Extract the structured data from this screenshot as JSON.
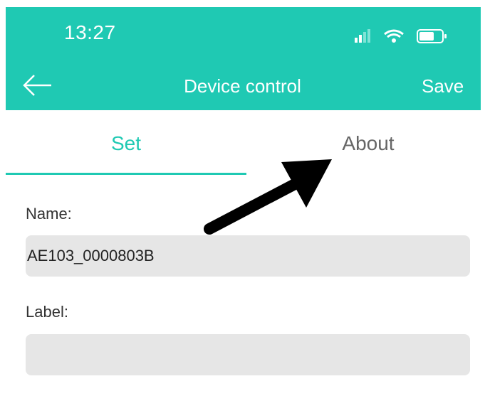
{
  "status_bar": {
    "time": "13:27",
    "icons": [
      "cellular-signal-icon",
      "wifi-icon",
      "battery-icon"
    ]
  },
  "nav_bar": {
    "back_icon": "arrow-left-icon",
    "title": "Device control",
    "save_label": "Save",
    "background_color": "#1fc9b3"
  },
  "tabs": [
    {
      "label": "Set",
      "active": true
    },
    {
      "label": "About",
      "active": false
    }
  ],
  "form": {
    "name": {
      "label": "Name:",
      "value": "AE103_0000803B"
    },
    "label": {
      "label": "Label:",
      "value": ""
    }
  },
  "colors": {
    "accent": "#1fc9b3",
    "input_background": "#e6e6e6"
  }
}
